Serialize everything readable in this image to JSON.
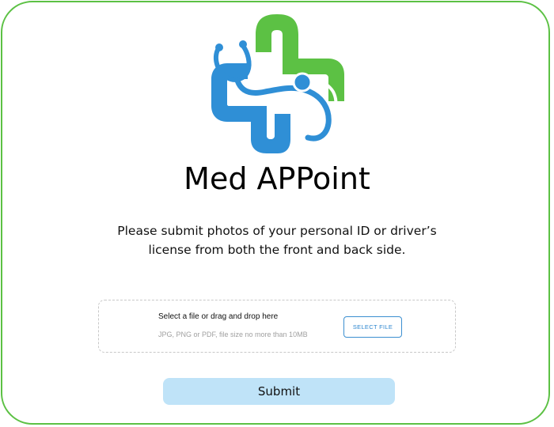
{
  "app": {
    "name": "Med APPoint"
  },
  "instructions": {
    "line1": "Please submit photos of your personal ID or driver’s",
    "line2": "license from both the front and back side."
  },
  "upload": {
    "title": "Select a file or drag and drop here",
    "hint": "JPG, PNG or PDF, file size no more than 10MB",
    "select_label": "SELECT FILE"
  },
  "submit": {
    "label": "Submit"
  },
  "colors": {
    "border_green": "#5cc144",
    "logo_green": "#5cc144",
    "logo_blue": "#2f8fd6",
    "submit_bg": "#bfe3f8",
    "select_blue": "#2c86cf"
  },
  "icons": {
    "logo": "medical-cross-stethoscope-logo"
  }
}
